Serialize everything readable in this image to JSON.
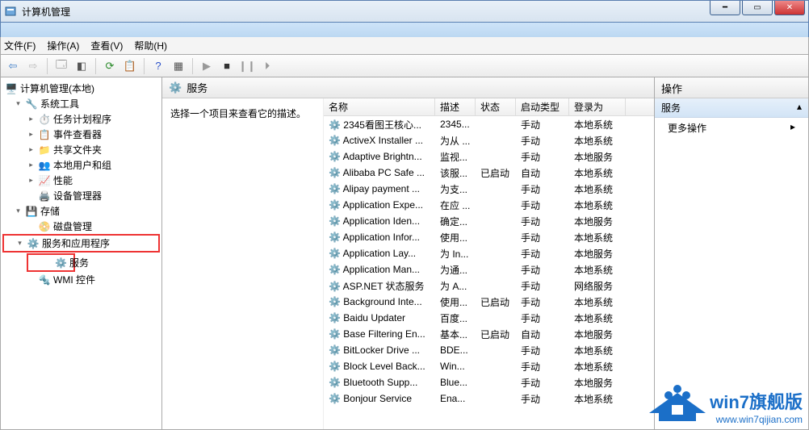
{
  "window": {
    "title": "计算机管理"
  },
  "menubar": {
    "file": "文件(F)",
    "action": "操作(A)",
    "view": "查看(V)",
    "help": "帮助(H)"
  },
  "tree": {
    "root": "计算机管理(本地)",
    "sys_tools": "系统工具",
    "task_sched": "任务计划程序",
    "event_viewer": "事件查看器",
    "shared_folders": "共享文件夹",
    "local_users": "本地用户和组",
    "performance": "性能",
    "device_mgr": "设备管理器",
    "storage": "存储",
    "disk_mgmt": "磁盘管理",
    "svc_apps": "服务和应用程序",
    "services": "服务",
    "wmi": "WMI 控件"
  },
  "mid": {
    "header": "服务",
    "hint": "选择一个项目来查看它的描述。",
    "cols": {
      "name": "名称",
      "desc": "描述",
      "stat": "状态",
      "start": "启动类型",
      "logon": "登录为"
    }
  },
  "services": [
    {
      "name": "2345看图王核心...",
      "desc": "2345...",
      "stat": "",
      "start": "手动",
      "logon": "本地系统"
    },
    {
      "name": "ActiveX Installer ...",
      "desc": "为从 ...",
      "stat": "",
      "start": "手动",
      "logon": "本地系统"
    },
    {
      "name": "Adaptive Brightn...",
      "desc": "监视...",
      "stat": "",
      "start": "手动",
      "logon": "本地服务"
    },
    {
      "name": "Alibaba PC Safe ...",
      "desc": "该服...",
      "stat": "已启动",
      "start": "自动",
      "logon": "本地系统"
    },
    {
      "name": "Alipay payment ...",
      "desc": "为支...",
      "stat": "",
      "start": "手动",
      "logon": "本地系统"
    },
    {
      "name": "Application Expe...",
      "desc": "在应 ...",
      "stat": "",
      "start": "手动",
      "logon": "本地系统"
    },
    {
      "name": "Application Iden...",
      "desc": "确定...",
      "stat": "",
      "start": "手动",
      "logon": "本地服务"
    },
    {
      "name": "Application Infor...",
      "desc": "使用...",
      "stat": "",
      "start": "手动",
      "logon": "本地系统"
    },
    {
      "name": "Application Lay...",
      "desc": "为 In...",
      "stat": "",
      "start": "手动",
      "logon": "本地服务"
    },
    {
      "name": "Application Man...",
      "desc": "为通...",
      "stat": "",
      "start": "手动",
      "logon": "本地系统"
    },
    {
      "name": "ASP.NET 状态服务",
      "desc": "为 A...",
      "stat": "",
      "start": "手动",
      "logon": "网络服务"
    },
    {
      "name": "Background Inte...",
      "desc": "使用...",
      "stat": "已启动",
      "start": "手动",
      "logon": "本地系统"
    },
    {
      "name": "Baidu Updater",
      "desc": "百度...",
      "stat": "",
      "start": "手动",
      "logon": "本地系统"
    },
    {
      "name": "Base Filtering En...",
      "desc": "基本...",
      "stat": "已启动",
      "start": "自动",
      "logon": "本地服务"
    },
    {
      "name": "BitLocker Drive ...",
      "desc": "BDE...",
      "stat": "",
      "start": "手动",
      "logon": "本地系统"
    },
    {
      "name": "Block Level Back...",
      "desc": "Win...",
      "stat": "",
      "start": "手动",
      "logon": "本地系统"
    },
    {
      "name": "Bluetooth Supp...",
      "desc": "Blue...",
      "stat": "",
      "start": "手动",
      "logon": "本地服务"
    },
    {
      "name": "Bonjour Service",
      "desc": "Ena...",
      "stat": "",
      "start": "手动",
      "logon": "本地系统"
    }
  ],
  "actions": {
    "header": "操作",
    "sub": "服务",
    "more": "更多操作"
  },
  "watermark": {
    "big": "win7旗舰版",
    "url": "www.win7qijian.com"
  }
}
